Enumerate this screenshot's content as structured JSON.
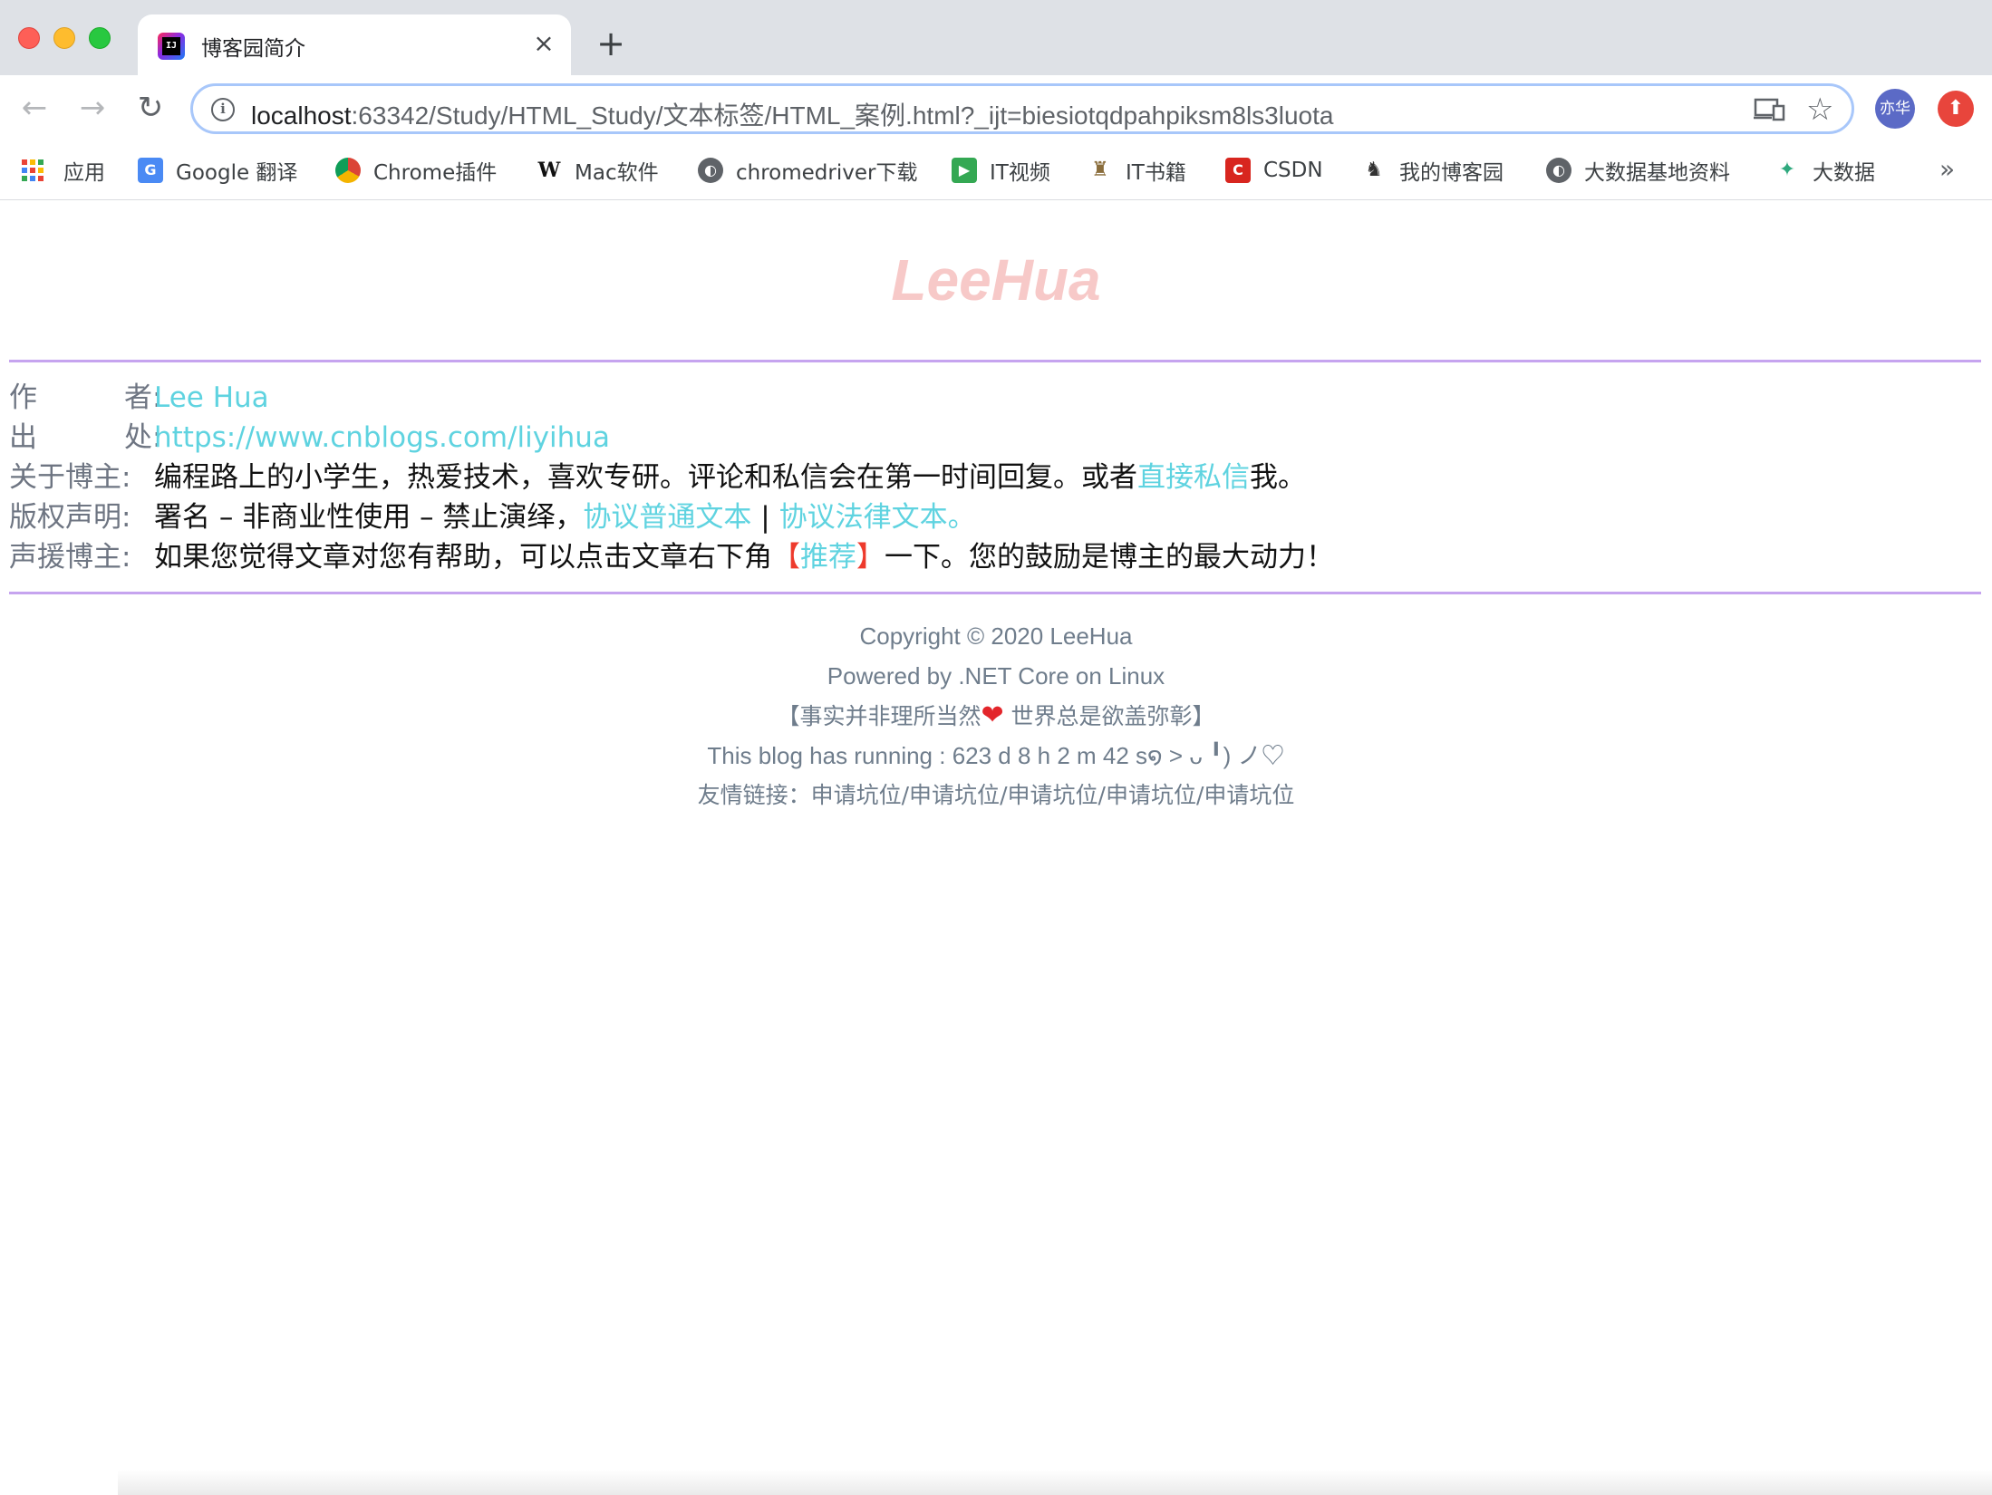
{
  "browser": {
    "tab_title": "博客园简介",
    "tab_close": "×",
    "new_tab": "+",
    "url_host": "localhost",
    "url_rest": ":63342/Study/HTML_Study/文本标签/HTML_案例.html?_ijt=biesiotqdpahpiksm8ls3luota",
    "profile_label": "亦华",
    "back_icon": "←",
    "forward_icon": "→",
    "reload_icon": "↻",
    "star_icon": "☆",
    "ext_icon": "⬆"
  },
  "bookmarks": {
    "items": [
      {
        "label": "应用",
        "icon": "apps-grid-icon"
      },
      {
        "label": "Google 翻译",
        "icon": "google-translate-icon",
        "color": "#4a8af4"
      },
      {
        "label": "Chrome插件",
        "icon": "chrome-icon",
        "color": "#db4437"
      },
      {
        "label": "Mac软件",
        "icon": "mac-software-icon",
        "color": "#111111"
      },
      {
        "label": "chromedriver下载",
        "icon": "globe-icon",
        "color": "#5f6368"
      },
      {
        "label": "IT视频",
        "icon": "it-video-icon",
        "color": "#34a853"
      },
      {
        "label": "IT书籍",
        "icon": "it-books-icon",
        "color": "#8a6d3b"
      },
      {
        "label": "CSDN",
        "icon": "csdn-icon",
        "color": "#d8261f"
      },
      {
        "label": "我的博客园",
        "icon": "cnblogs-icon",
        "color": "#333333"
      },
      {
        "label": "大数据基地资料",
        "icon": "globe-icon",
        "color": "#5f6368"
      },
      {
        "label": "大数据",
        "icon": "bigdata-icon",
        "color": "#2fa97e"
      }
    ],
    "more": "»"
  },
  "page": {
    "site_title": "LeeHua",
    "info": {
      "author_label_a": "作",
      "author_label_b": "者:",
      "author_value": "Lee Hua",
      "source_label_a": "出",
      "source_label_b": "处:",
      "source_value": "https://www.cnblogs.com/liyihua",
      "about_label": "关于博主:",
      "about_text": "编程路上的小学生，热爱技术，喜欢专研。评论和私信会在第一时间回复。或者",
      "about_link": "直接私信",
      "about_tail": "我。",
      "copyright_label": "版权声明:",
      "copyright_text": "署名 – 非商业性使用 – 禁止演绎，",
      "copyright_link1": "协议普通文本",
      "copyright_sep": " | ",
      "copyright_link2": "协议法律文本。",
      "support_label": "声援博主:",
      "support_text": "如果您觉得文章对您有帮助，可以点击文章右下角",
      "support_bracket_open": "【",
      "support_link": "推荐",
      "support_bracket_close": "】",
      "support_tail": "一下。您的鼓励是博主的最大动力！"
    },
    "footer": {
      "copyright": "Copyright © 2020 LeeHua",
      "powered": "Powered by .NET Core on Linux",
      "motto_left": "【事实并非理所当然",
      "motto_heart": "❤",
      "motto_right": " 世界总是欲盖弥彰】",
      "running": "This blog has running : 623 d 8 h 2 m 42 s໑ >  ᴗ ╹) ノ♡",
      "friends_label": "友情链接：",
      "friends": [
        "申请坑位",
        "申请坑位",
        "申请坑位",
        "申请坑位",
        "申请坑位"
      ],
      "friends_sep": "/"
    }
  },
  "colors": {
    "title_pink": "#f7c9c8",
    "rule_purple": "#c6a4ef",
    "link_cyan": "#5fd3e0",
    "label_gray": "#6e7582",
    "footer_gray": "#6f7d8c"
  }
}
